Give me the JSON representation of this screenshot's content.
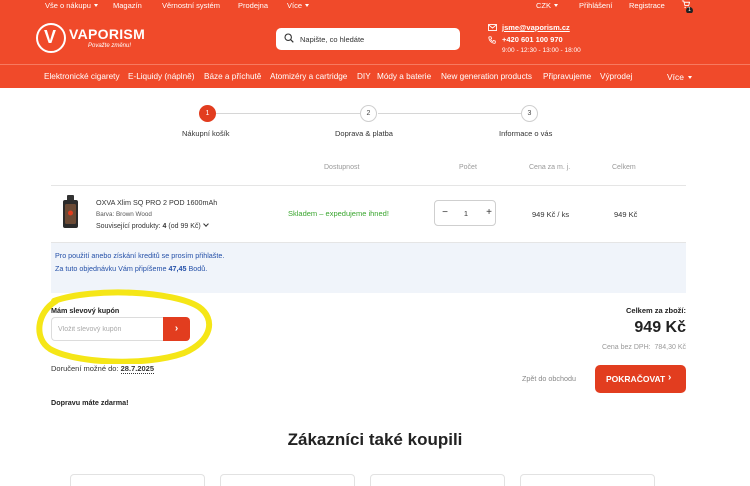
{
  "topbar": {
    "items": [
      "Vše o nákupu",
      "Magazín",
      "Věrnostní systém",
      "Prodejna",
      "Více"
    ],
    "currency": "CZK",
    "login": "Přihlášení",
    "register": "Registrace",
    "cart_count": "1"
  },
  "header": {
    "logo_letter": "V",
    "logo_name": "VAPORISM",
    "logo_tagline": "Považte změnu!",
    "search_placeholder": "Napište, co hledáte",
    "email": "jsme@vaporism.cz",
    "phone": "+420 601 100 970",
    "hours": "9:00 - 12:30 - 13:00 - 18:00"
  },
  "categories": [
    "Elektronické cigarety",
    "E-Liquidy (náplně)",
    "Báze a příchutě",
    "Atomizéry a cartridge",
    "DIY",
    "Módy a baterie",
    "New generation products",
    "Připravujeme",
    "Výprodej"
  ],
  "more_label": "Více",
  "steps": [
    {
      "num": "1",
      "label": "Nákupní košík"
    },
    {
      "num": "2",
      "label": "Doprava & platba"
    },
    {
      "num": "3",
      "label": "Informace o vás"
    }
  ],
  "table": {
    "headers": {
      "availability": "Dostupnost",
      "count": "Počet",
      "unit_price": "Cena za m. j.",
      "total": "Celkem"
    },
    "item": {
      "name": "OXVA Xlim SQ PRO 2 POD 1600mAh",
      "color": "Barva: Brown Wood",
      "related_label": "Související produkty:",
      "related_value": "4",
      "related_price": "(od 99 Kč)",
      "stock": "Skladem – expedujeme ihned!",
      "qty": "1",
      "unit_price": "949 Kč / ks",
      "total": "949 Kč"
    }
  },
  "info": {
    "line1": "Pro použití anebo získání kreditů se prosím přihlašte.",
    "line2_pre": "Za tuto objednávku Vám připíšeme",
    "line2_value": "47,45",
    "line2_post": "Bodů."
  },
  "coupon": {
    "title": "Mám slevový kupón",
    "placeholder": "Vložit slevový kupón",
    "button_icon": "›"
  },
  "delivery": {
    "label": "Doručení možné do:",
    "date": "28.7.2025",
    "free": "Dopravu máte zdarma!"
  },
  "totals": {
    "label": "Celkem za zboží:",
    "value": "949 Kč",
    "no_vat_label": "Cena bez DPH:",
    "no_vat_value": "784,30 Kč"
  },
  "actions": {
    "back": "Zpět do obchodu",
    "continue": "POKRAČOVAT",
    "continue_icon": "›"
  },
  "also_bought": "Zákazníci také koupili",
  "colors": {
    "brand": "#f04a2a",
    "button": "#e23d1f",
    "stock": "#3aa62f",
    "info_text": "#2450a8",
    "highlight": "#f5e617"
  }
}
